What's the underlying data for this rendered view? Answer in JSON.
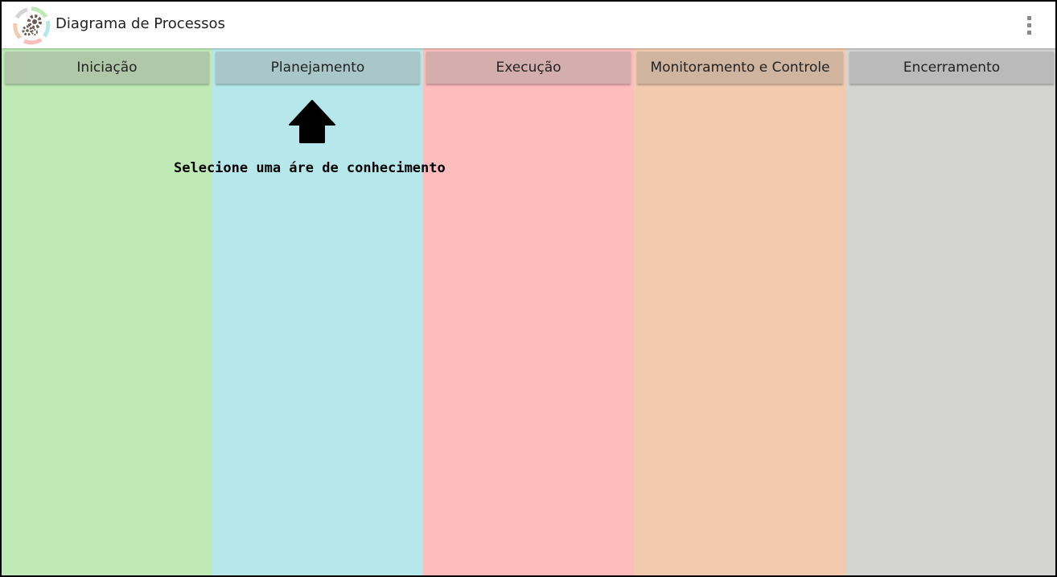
{
  "app": {
    "title": "Diagrama de Processos",
    "logo_icon": "gears-process-cycle-icon",
    "menu_icon": "overflow-menu-icon"
  },
  "phases": [
    {
      "label": "Iniciação",
      "bg": "#bfeab6",
      "button": "#b1c8a8"
    },
    {
      "label": "Planejamento",
      "bg": "#b6e8eb",
      "button": "#a9c6c9"
    },
    {
      "label": "Execução",
      "bg": "#fdbdbc",
      "button": "#d4aead"
    },
    {
      "label": "Monitoramento e Controle",
      "bg": "#f2cbae",
      "button": "#cfb4a0"
    },
    {
      "label": "Encerramento",
      "bg": "#d4d4d3",
      "button": "#bababa"
    }
  ],
  "hint": {
    "text": "Selecione uma áre de conhecimento",
    "icon": "arrow-up-icon"
  }
}
